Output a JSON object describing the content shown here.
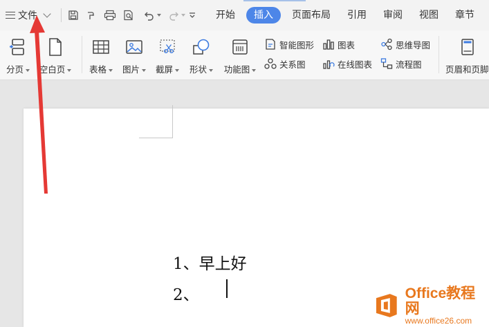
{
  "topbar": {
    "file_label": "文件",
    "tabs": [
      {
        "label": "开始",
        "active": false
      },
      {
        "label": "插入",
        "active": true
      },
      {
        "label": "页面布局",
        "active": false
      },
      {
        "label": "引用",
        "active": false
      },
      {
        "label": "审阅",
        "active": false
      },
      {
        "label": "视图",
        "active": false
      },
      {
        "label": "章节",
        "active": false
      }
    ]
  },
  "ribbon": {
    "page_break": "分页",
    "blank_page": "空白页",
    "table": "表格",
    "picture": "图片",
    "screenshot": "截屏",
    "shapes": "形状",
    "function_chart": "功能图",
    "smart_art": "智能图形",
    "chart": "图表",
    "relation_chart": "关系图",
    "online_chart": "在线图表",
    "mind_map": "思维导图",
    "flowchart": "流程图",
    "header_footer": "页眉和页脚"
  },
  "document": {
    "lines": [
      "1、早上好",
      "2、"
    ]
  },
  "watermark": {
    "title": "Office教程网",
    "url": "www.office26.com"
  },
  "colors": {
    "active_tab": "#4d86e8",
    "arrow": "#e53935",
    "watermark": "#e8781e"
  }
}
